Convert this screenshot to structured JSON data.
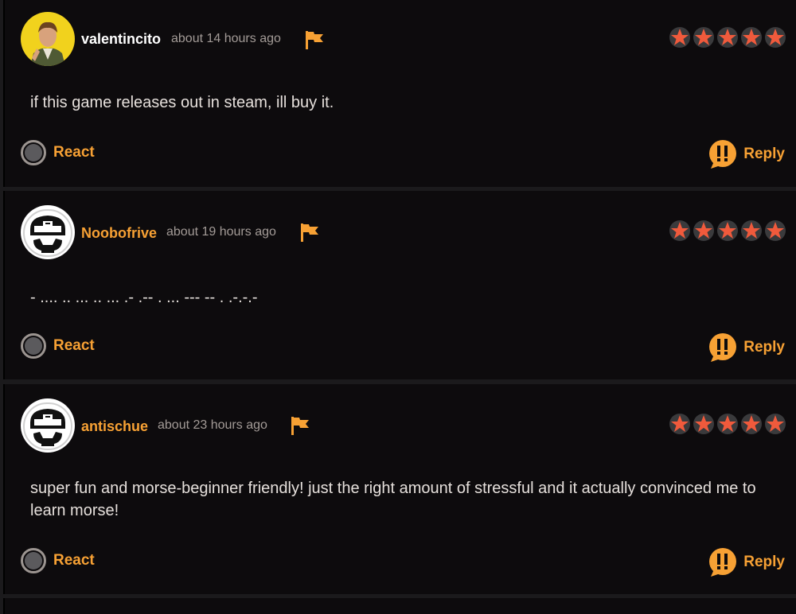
{
  "comments": [
    {
      "username": "valentincito",
      "time": "about 14 hours ago",
      "rating": 5,
      "body": "if this game releases out in steam, ill buy it.",
      "react_label": "React",
      "reply_label": "Reply"
    },
    {
      "username": "Noobofrive",
      "time": "about 19 hours ago",
      "rating": 5,
      "body": "- .... .. ... .. ... .- .-- . ... --- -- . .-.-.-",
      "react_label": "React",
      "reply_label": "Reply"
    },
    {
      "username": "antischue",
      "time": "about 23 hours ago",
      "rating": 5,
      "body": "super fun and morse-beginner friendly! just the right amount of stressful and it actually convinced me to learn morse!",
      "react_label": "React",
      "reply_label": "Reply"
    }
  ],
  "colors": {
    "accent": "#f7a134",
    "star": "#f05a3c",
    "background": "#0d0b0d"
  },
  "icons": {
    "flag": "flag-icon",
    "star": "star-icon",
    "react": "react-circle-icon",
    "reply": "reply-speech-bubble-icon"
  }
}
